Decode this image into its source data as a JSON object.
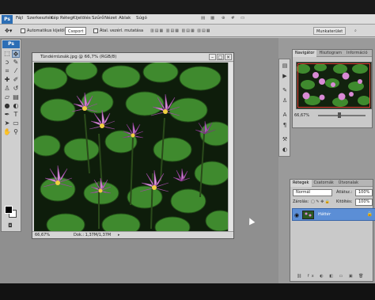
{
  "app": {
    "logo": "Ps"
  },
  "menubar": {
    "items": [
      "Fájl",
      "Szerkesztés",
      "Kép",
      "Réteg",
      "Kijelölés",
      "Szűrő",
      "Nézet",
      "Ablak",
      "Súgó"
    ],
    "icons": [
      "bridge-icon",
      "minibridge-icon",
      "zoom-level-icon",
      "grid-icon",
      "screen-mode-icon"
    ],
    "workspace": "Munkaterület"
  },
  "options": {
    "auto_select_label": "Automatikus kijelölés:",
    "auto_select_value": "Csoport",
    "show_transform_label": "Átal. vezérl. mutatása"
  },
  "toolbar": {
    "logo": "Ps",
    "tools": [
      "move-icon",
      "marquee-icon",
      "lasso-icon",
      "quick-select-icon",
      "crop-icon",
      "eyedropper-icon",
      "healing-icon",
      "brush-icon",
      "clone-stamp-icon",
      "history-brush-icon",
      "eraser-icon",
      "gradient-icon",
      "blur-icon",
      "dodge-icon",
      "pen-icon",
      "type-icon",
      "path-select-icon",
      "shape-icon",
      "hand-icon",
      "zoom-icon"
    ]
  },
  "document": {
    "title": "Tündérrózsák.jpg @ 66,7% (RGB/8)",
    "zoom": "66,67%",
    "doc_size": "Dok.: 1,37M/1,37M"
  },
  "navigator": {
    "tabs": [
      "Navigátor",
      "Hisztogram",
      "Információ"
    ],
    "zoom": "66,67%",
    "zoom_fraction": 0.45
  },
  "layers": {
    "tabs": [
      "Rétegek",
      "Csatornák",
      "Útvonalak"
    ],
    "mode_value": "Normál",
    "opacity_label": "Átlátsz.:",
    "opacity_value": "100%",
    "lock_label": "Zárolás:",
    "fill_label": "Kitöltés:",
    "fill_value": "100%",
    "layer_name": "Háttér"
  },
  "colors": {
    "accent": "#2c6eb5",
    "selection": "#5b8ed6",
    "nav_frame": "#e43c3c"
  }
}
